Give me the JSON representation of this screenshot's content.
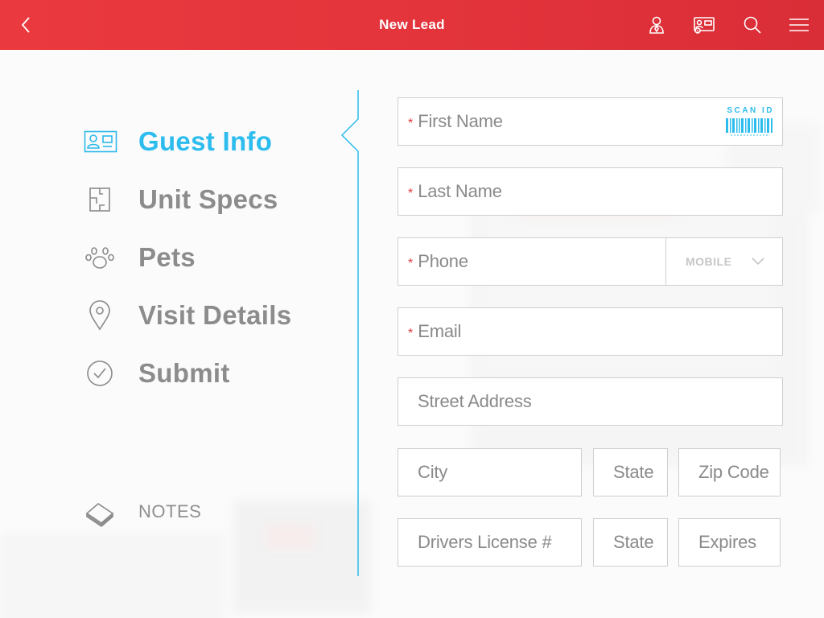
{
  "header": {
    "title": "New Lead",
    "icons": [
      "back-icon",
      "agent-icon",
      "id-card-icon",
      "search-icon",
      "menu-icon"
    ],
    "color": "#e2333b"
  },
  "nav": {
    "accent": "#2cbcee",
    "items": [
      {
        "label": "Guest Info",
        "icon": "id-card-icon",
        "active": true
      },
      {
        "label": "Unit Specs",
        "icon": "floorplan-icon",
        "active": false
      },
      {
        "label": "Pets",
        "icon": "paw-icon",
        "active": false
      },
      {
        "label": "Visit Details",
        "icon": "location-pin-icon",
        "active": false
      },
      {
        "label": "Submit",
        "icon": "check-circle-icon",
        "active": false
      }
    ],
    "notes_label": "NOTES"
  },
  "form": {
    "required_mark": "*",
    "first_name": "First Name",
    "scan_id": "SCAN ID",
    "last_name": "Last Name",
    "phone": "Phone",
    "phone_type": "MOBILE",
    "email": "Email",
    "street": "Street Address",
    "city": "City",
    "state": "State",
    "zip": "Zip Code",
    "license": "Drivers License #",
    "license_state": "State",
    "expires": "Expires"
  }
}
